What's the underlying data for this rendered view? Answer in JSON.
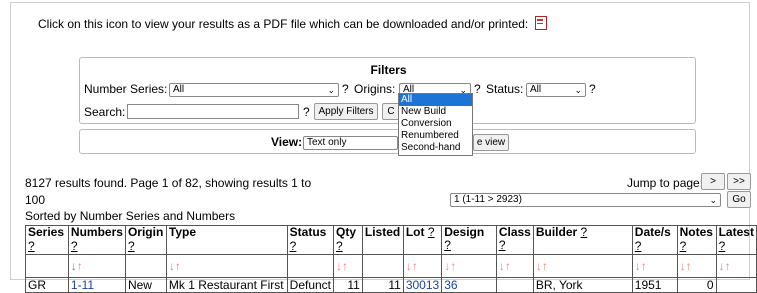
{
  "pdf_line": {
    "text": "Click on this icon to view your results as a PDF file which can be downloaded and/or printed:",
    "icon": "pdf-icon"
  },
  "filters": {
    "title": "Filters",
    "number_series_label": "Number Series:",
    "number_series_value": "All",
    "origins_label": "Origins:",
    "origins_value": "All",
    "status_label": "Status:",
    "status_value": "All",
    "search_label": "Search:",
    "search_value": "",
    "apply_label": "Apply Filters",
    "clear_label": "C",
    "help": "?",
    "origins_options": [
      "All",
      "New Build",
      "Conversion",
      "Renumbered",
      "Second-hand"
    ]
  },
  "view": {
    "label": "View:",
    "value": "Text only",
    "button": "e view"
  },
  "results": {
    "line1": "8127 results found. Page 1 of 82, showing results 1 to",
    "line2": "100",
    "sorted": "Sorted by Number Series and Numbers"
  },
  "jump": {
    "label": "Jump to page:",
    "next": ">",
    "last": ">>",
    "page_value": "1 (1-11 > 2923)",
    "go": "Go"
  },
  "table": {
    "headers": [
      "Series",
      "Numbers",
      "Origin",
      "Type",
      "Status",
      "Qty",
      "Listed",
      "Lot",
      "Design",
      "Class",
      "Builder",
      "Date/s",
      "Notes",
      "Latest"
    ],
    "row": [
      "GR",
      "1-11",
      "New",
      "Mk 1 Restaurant First",
      "Defunct",
      "11",
      "11",
      "30013",
      "36",
      "",
      "BR, York",
      "1951",
      "0",
      ""
    ]
  },
  "colors": {
    "sort_arrow": "#f08080",
    "active_sort": "#33aa33",
    "highlight": "#1e74d6",
    "link": "#1a3fa8"
  }
}
